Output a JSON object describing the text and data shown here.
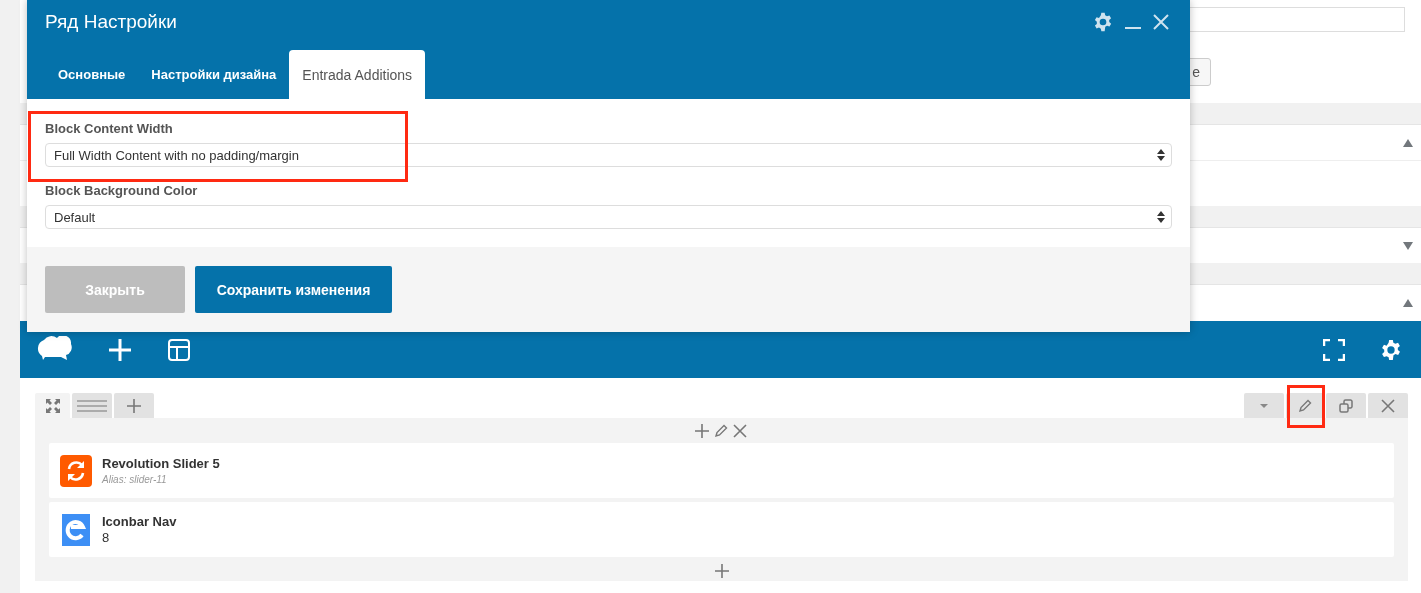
{
  "page": {
    "button": {
      "label": "е"
    },
    "panels": [
      {
        "expanded": true
      },
      {
        "expanded": false
      },
      {
        "expanded": true
      }
    ]
  },
  "dialog": {
    "title": "Ряд Настройки",
    "tabs": [
      {
        "label": "Основные",
        "selected": false
      },
      {
        "label": "Настройки дизайна",
        "selected": false
      },
      {
        "label": "Entrada Additions",
        "selected": true
      }
    ],
    "fields": [
      {
        "label": "Block Content Width",
        "value": "Full Width Content with no padding/margin",
        "highlighted": true
      },
      {
        "label": "Block Background Color",
        "value": "Default",
        "highlighted": false
      }
    ],
    "buttons": [
      {
        "label": "Закрыть",
        "kind": "secondary"
      },
      {
        "label": "Сохранить изменения",
        "kind": "primary"
      }
    ]
  },
  "builder": {
    "row": {
      "left_tools": [
        {
          "kind": "expand",
          "highlighted": false
        },
        {
          "kind": "drag",
          "highlighted": false
        },
        {
          "kind": "add",
          "highlighted": false
        }
      ],
      "right_tools": [
        {
          "kind": "menu",
          "highlighted": false
        },
        {
          "kind": "edit",
          "highlighted": true
        },
        {
          "kind": "copy",
          "highlighted": false
        },
        {
          "kind": "delete",
          "highlighted": false
        }
      ],
      "column_tools": [
        {
          "kind": "add"
        },
        {
          "kind": "edit"
        },
        {
          "kind": "delete"
        }
      ],
      "elements": [
        {
          "kind": "slider",
          "title": "Revolution Slider 5",
          "subtitle": "Alias: slider-11"
        },
        {
          "kind": "iconbar",
          "title": "Iconbar Nav",
          "subtitle": "8"
        }
      ]
    }
  }
}
